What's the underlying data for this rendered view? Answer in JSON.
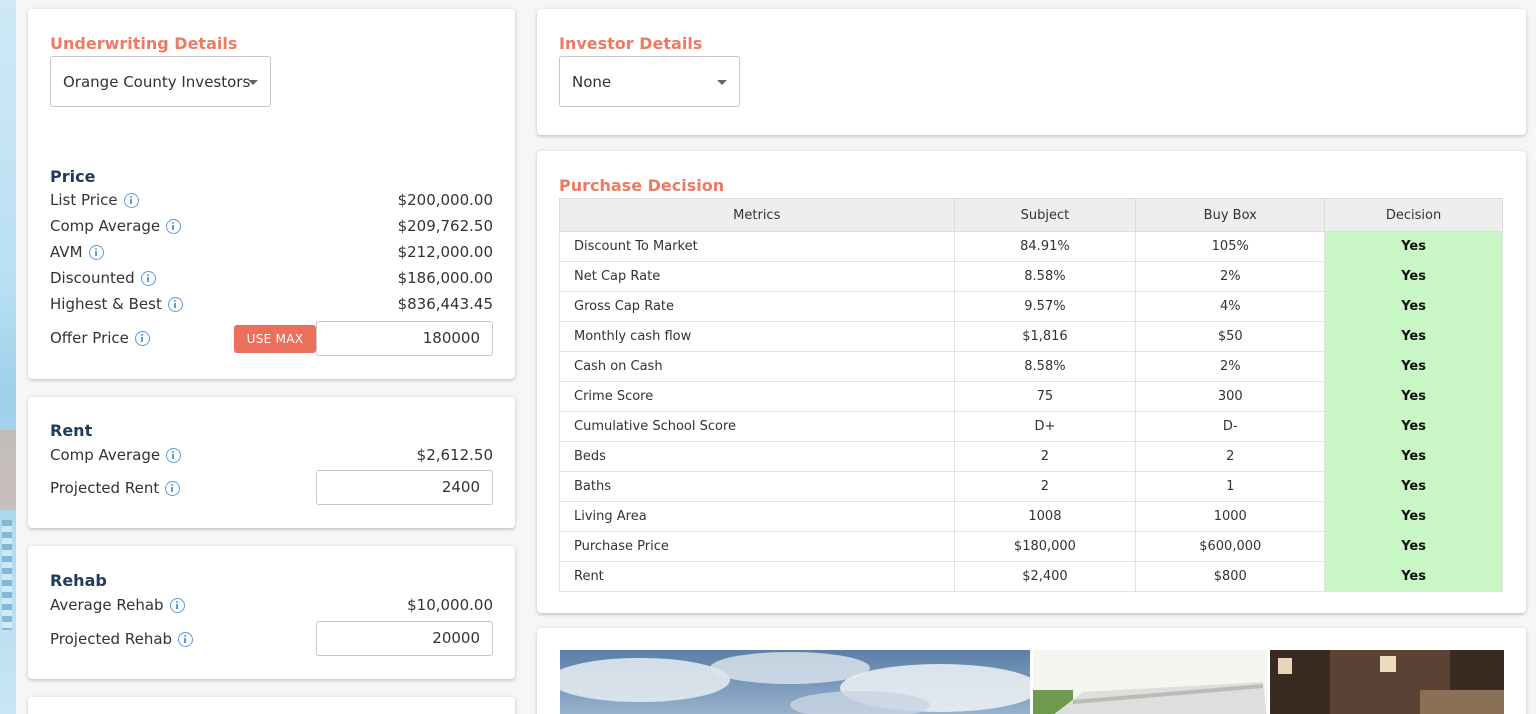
{
  "underwriting": {
    "title": "Underwriting Details",
    "selected": "Orange County Investors"
  },
  "investor": {
    "title": "Investor Details",
    "selected": "None"
  },
  "price": {
    "title": "Price",
    "list_price_label": "List Price",
    "list_price": "$200,000.00",
    "comp_avg_label": "Comp Average",
    "comp_avg": "$209,762.50",
    "avm_label": "AVM",
    "avm": "$212,000.00",
    "discounted_label": "Discounted",
    "discounted": "$186,000.00",
    "highest_best_label": "Highest & Best",
    "highest_best": "$836,443.45",
    "offer_price_label": "Offer Price",
    "use_max_label": "USE MAX",
    "offer_price_value": "180000"
  },
  "rent": {
    "title": "Rent",
    "comp_avg_label": "Comp Average",
    "comp_avg": "$2,612.50",
    "projected_label": "Projected Rent",
    "projected_value": "2400"
  },
  "rehab": {
    "title": "Rehab",
    "avg_label": "Average Rehab",
    "avg": "$10,000.00",
    "projected_label": "Projected Rehab",
    "projected_value": "20000"
  },
  "purchase_decision": {
    "title": "Purchase Decision",
    "headers": [
      "Metrics",
      "Subject",
      "Buy Box",
      "Decision"
    ],
    "rows": [
      {
        "metric": "Discount To Market",
        "subject": "84.91%",
        "buybox": "105%",
        "decision": "Yes"
      },
      {
        "metric": "Net Cap Rate",
        "subject": "8.58%",
        "buybox": "2%",
        "decision": "Yes"
      },
      {
        "metric": "Gross Cap Rate",
        "subject": "9.57%",
        "buybox": "4%",
        "decision": "Yes"
      },
      {
        "metric": "Monthly cash flow",
        "subject": "$1,816",
        "buybox": "$50",
        "decision": "Yes"
      },
      {
        "metric": "Cash on Cash",
        "subject": "8.58%",
        "buybox": "2%",
        "decision": "Yes"
      },
      {
        "metric": "Crime Score",
        "subject": "75",
        "buybox": "300",
        "decision": "Yes"
      },
      {
        "metric": "Cumulative School Score",
        "subject": "D+",
        "buybox": "D-",
        "decision": "Yes"
      },
      {
        "metric": "Beds",
        "subject": "2",
        "buybox": "2",
        "decision": "Yes"
      },
      {
        "metric": "Baths",
        "subject": "2",
        "buybox": "1",
        "decision": "Yes"
      },
      {
        "metric": "Living Area",
        "subject": "1008",
        "buybox": "1000",
        "decision": "Yes"
      },
      {
        "metric": "Purchase Price",
        "subject": "$180,000",
        "buybox": "$600,000",
        "decision": "Yes"
      },
      {
        "metric": "Rent",
        "subject": "$2,400",
        "buybox": "$800",
        "decision": "Yes"
      }
    ]
  },
  "colors": {
    "accent": "#ef7a63",
    "section_title": "#1f3a5a",
    "yes_bg": "#c8f7c5",
    "info_icon": "#5b9be0"
  }
}
